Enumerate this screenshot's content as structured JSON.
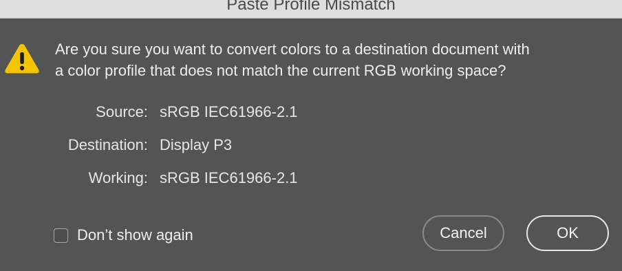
{
  "window": {
    "title": "Paste Profile Mismatch"
  },
  "icon": {
    "name": "warning-icon",
    "color": "#f5c400",
    "glyph": "!"
  },
  "message": {
    "line1": "Are you sure you want to convert colors to a destination document with",
    "line2": "a color profile that does not match the current RGB working space?"
  },
  "profiles": {
    "source": {
      "label": "Source:",
      "value": "sRGB IEC61966-2.1"
    },
    "destination": {
      "label": "Destination:",
      "value": "Display P3"
    },
    "working": {
      "label": "Working:",
      "value": "sRGB IEC61966-2.1"
    }
  },
  "options": {
    "dont_show_again": {
      "label": "Don’t show again",
      "checked": false
    }
  },
  "buttons": {
    "cancel": "Cancel",
    "ok": "OK"
  },
  "colors": {
    "background": "#545454",
    "titlebar": "#dedede",
    "text": "#eeeeee",
    "default_button_border": "#e8e8e8"
  }
}
